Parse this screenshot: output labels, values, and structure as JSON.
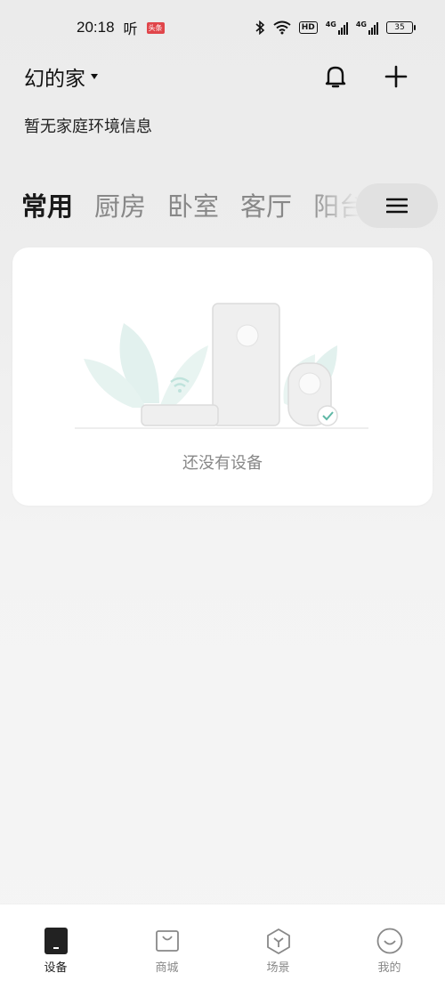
{
  "status_bar": {
    "time": "20:18",
    "app_badge": "听",
    "news_badge": "头条",
    "network_hd": "HD",
    "network_4g_1": "4G",
    "network_4g_2": "4G",
    "battery": "35"
  },
  "header": {
    "home_name": "幻的家",
    "bell_icon": "bell-icon",
    "add_icon": "plus-icon"
  },
  "environment_info": "暂无家庭环境信息",
  "tabs": [
    {
      "label": "常用",
      "active": true
    },
    {
      "label": "厨房",
      "active": false
    },
    {
      "label": "卧室",
      "active": false
    },
    {
      "label": "客厅",
      "active": false
    },
    {
      "label": "阳台",
      "active": false
    }
  ],
  "empty_state": {
    "message": "还没有设备"
  },
  "bottom_nav": [
    {
      "label": "设备",
      "icon": "device-icon",
      "active": true
    },
    {
      "label": "商城",
      "icon": "shopping-bag-icon",
      "active": false
    },
    {
      "label": "场景",
      "icon": "cube-icon",
      "active": false
    },
    {
      "label": "我的",
      "icon": "smile-icon",
      "active": false
    }
  ],
  "colors": {
    "accent_dark": "#222222",
    "inactive": "#888888",
    "illustration_teal": "#d8ece8"
  }
}
